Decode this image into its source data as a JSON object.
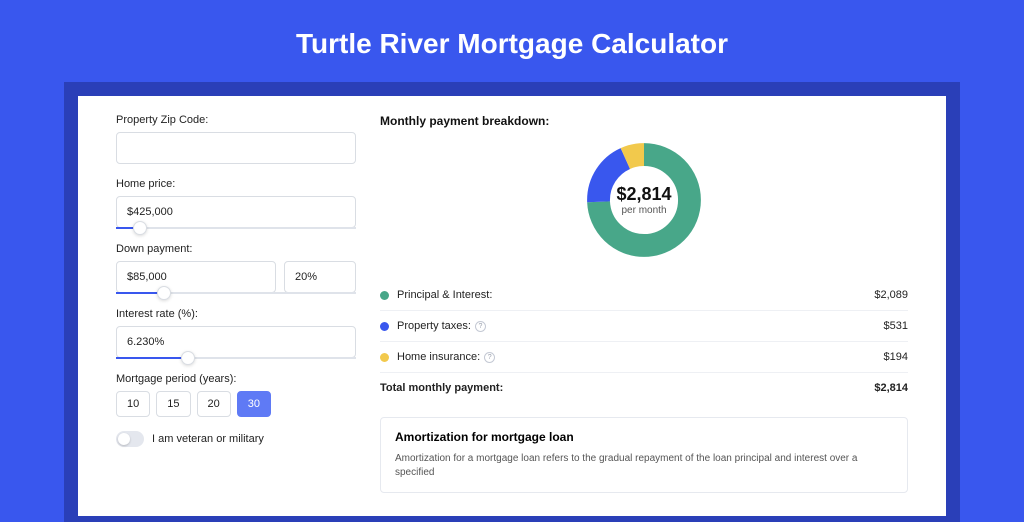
{
  "title": "Turtle River Mortgage Calculator",
  "form": {
    "zip": {
      "label": "Property Zip Code:",
      "value": ""
    },
    "home_price": {
      "label": "Home price:",
      "value": "$425,000",
      "slider_pct": 10
    },
    "down_payment": {
      "label": "Down payment:",
      "value": "$85,000",
      "pct": "20%",
      "slider_pct": 20
    },
    "interest": {
      "label": "Interest rate (%):",
      "value": "6.230%",
      "slider_pct": 30
    },
    "period": {
      "label": "Mortgage period (years):",
      "options": [
        "10",
        "15",
        "20",
        "30"
      ],
      "selected": "30"
    },
    "veteran": {
      "label": "I am veteran or military",
      "checked": false
    }
  },
  "breakdown": {
    "title": "Monthly payment breakdown:",
    "center_value": "$2,814",
    "center_sub": "per month",
    "items": [
      {
        "label": "Principal & Interest:",
        "value": "$2,089",
        "color": "#48a789",
        "info": false
      },
      {
        "label": "Property taxes:",
        "value": "$531",
        "color": "#3957ee",
        "info": true
      },
      {
        "label": "Home insurance:",
        "value": "$194",
        "color": "#f2c94c",
        "info": true
      }
    ],
    "total_label": "Total monthly payment:",
    "total_value": "$2,814"
  },
  "amort": {
    "title": "Amortization for mortgage loan",
    "text": "Amortization for a mortgage loan refers to the gradual repayment of the loan principal and interest over a specified"
  },
  "chart_data": {
    "type": "pie",
    "title": "Monthly payment breakdown",
    "series": [
      {
        "name": "Principal & Interest",
        "value": 2089,
        "color": "#48a789"
      },
      {
        "name": "Property taxes",
        "value": 531,
        "color": "#3957ee"
      },
      {
        "name": "Home insurance",
        "value": 194,
        "color": "#f2c94c"
      }
    ],
    "total": 2814,
    "center_label": "$2,814 per month"
  }
}
